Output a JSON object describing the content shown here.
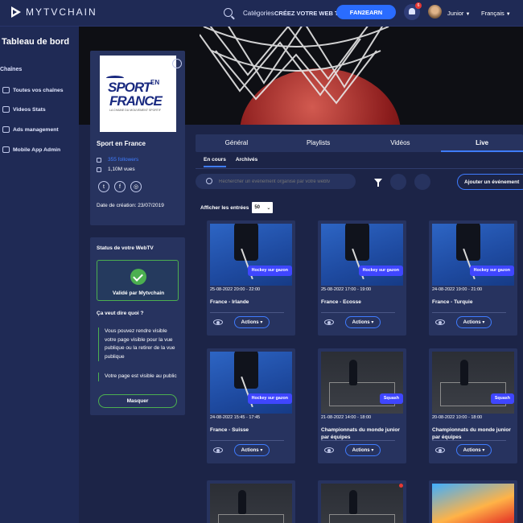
{
  "header": {
    "logo_text": "MYTVCHAIN",
    "nav_categories": "Catégories",
    "nav_create": "CRÉEZ VOTRE WEB TV",
    "fan_button": "FAN2EARN",
    "notif_count": "6",
    "user_name": "Junior",
    "language": "Français"
  },
  "sidebar": {
    "title": "Tableau de bord",
    "section": "Chaînes",
    "items": [
      {
        "label": "Toutes vos chaînes",
        "icon": "users-icon"
      },
      {
        "label": "Videos Stats",
        "icon": "stats-icon"
      },
      {
        "label": "Ads management",
        "icon": "ads-icon"
      },
      {
        "label": "Mobile App Admin",
        "icon": "mobile-icon"
      }
    ]
  },
  "profile": {
    "logo_sport": "SPORT",
    "logo_en": "EN",
    "logo_france": "FRANCE",
    "logo_tagline": "LA CHAINE DU MOUVEMENT SPORTIF",
    "name": "Sport en France",
    "followers": "355 followers",
    "views": "1,10M vues",
    "created": "Date de création: 23/07/2019"
  },
  "status": {
    "title": "Status de votre WebTV",
    "validated": "Validé par Mytvchain",
    "question": "Ça veut dire quoi ?",
    "text1": "Vous pouvez rendre visible votre page visible pour la vue publique ou la retirer de la vue publique",
    "text2": "Votre page est visible au public",
    "hide_button": "Masquer"
  },
  "tabs": [
    "Général",
    "Playlists",
    "Vidéos",
    "Live"
  ],
  "subtabs": [
    "En cours",
    "Archivés"
  ],
  "search": {
    "placeholder": "Rechercher un événement organisé par votre webtv"
  },
  "add_button": "Ajouter un événement",
  "entries": {
    "label": "Afficher les entrées",
    "value": "50"
  },
  "cards": [
    {
      "type": "hockey",
      "tag": "Hockey sur gazon",
      "date": "25-08-2022 20:00 - 22:00",
      "title": "France - Irlande",
      "action": "Actions"
    },
    {
      "type": "hockey",
      "tag": "Hockey sur gazon",
      "date": "25-08-2022 17:00 - 19:00",
      "title": "France - Ecosse",
      "action": "Actions"
    },
    {
      "type": "hockey",
      "tag": "Hockey sur gazon",
      "date": "24-08-2022 19:00 - 21:00",
      "title": "France - Turquie",
      "action": "Actions"
    },
    {
      "type": "hockey",
      "tag": "Hockey sur gazon",
      "date": "24-08-2022 15:45 - 17:45",
      "title": "France - Suisse",
      "action": "Actions"
    },
    {
      "type": "squash",
      "tag": "Squash",
      "date": "21-08-2022 14:00 - 18:00",
      "title": "Championnats du monde junior par équipes",
      "action": "Actions"
    },
    {
      "type": "squash",
      "tag": "Squash",
      "date": "20-08-2022 10:00 - 18:00",
      "title": "Championnats du monde junior par équipes",
      "action": "Actions"
    }
  ],
  "colors": {
    "accent": "#2a6cff",
    "success": "#4caf50",
    "background": "#1c2447",
    "panel": "#27335f"
  }
}
